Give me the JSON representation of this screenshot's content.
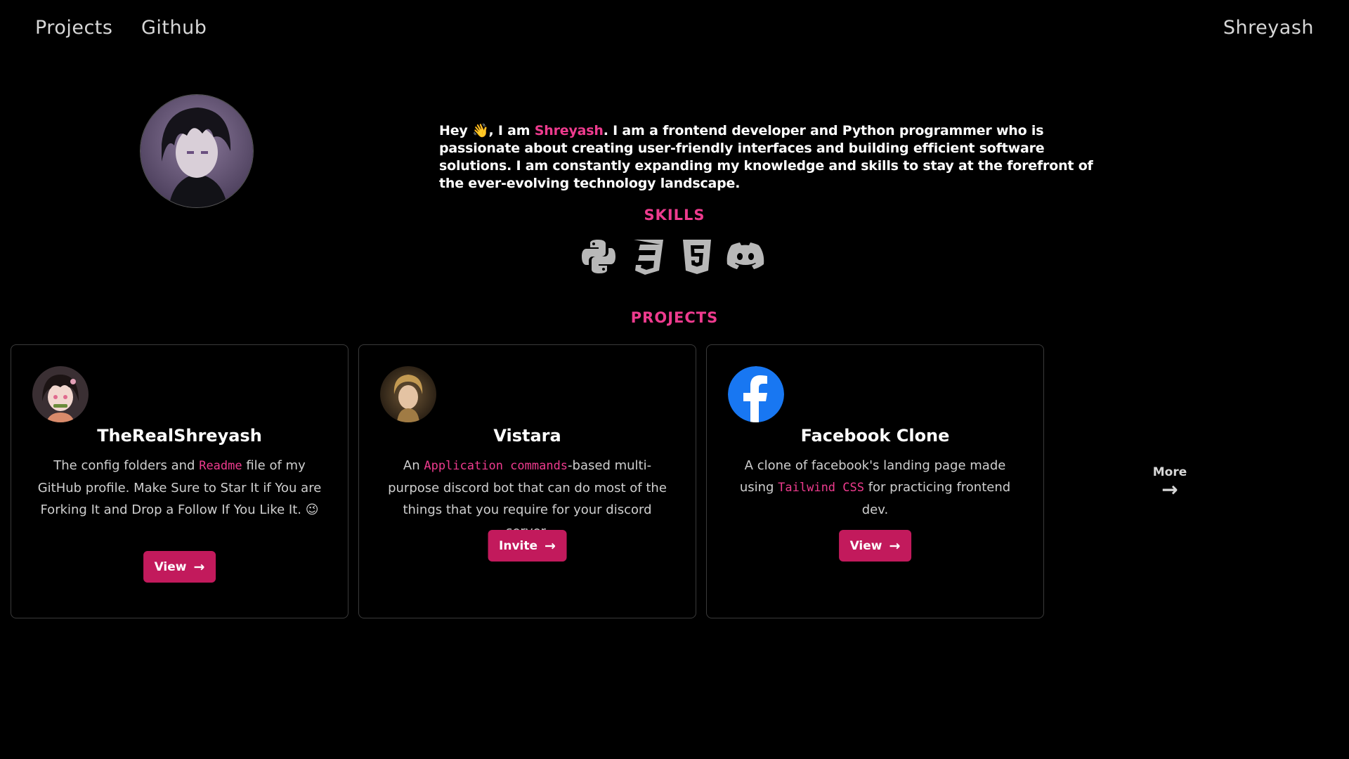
{
  "nav": {
    "projects": "Projects",
    "github": "Github",
    "brand": "Shreyash"
  },
  "bio": {
    "pre": "Hey 👋, I am ",
    "name": "Shreyash",
    "post": ". I am a frontend developer and Python programmer who is passionate about creating user-friendly interfaces and building efficient software solutions. I am constantly expanding my knowledge and skills to stay at the forefront of the ever-evolving technology landscape."
  },
  "skills": {
    "title": "SKILLS",
    "icons": [
      "python-icon",
      "css3-icon",
      "html5-icon",
      "discord-icon"
    ]
  },
  "projects": {
    "title": "PROJECTS",
    "cards": [
      {
        "title": "TheRealShreyash",
        "desc_before": "The config folders and ",
        "desc_code": "Readme",
        "desc_after": " file of my GitHub profile. Make Sure to Star It if You are Forking It and Drop a Follow If You Like It. 😉",
        "button": "View"
      },
      {
        "title": "Vistara",
        "desc_before": "An ",
        "desc_code": "Application commands",
        "desc_after": "-based multi-purpose discord bot that can do most of the things that you require for your discord server.",
        "button": "Invite"
      },
      {
        "title": "Facebook Clone",
        "desc_before": "A clone of facebook's landing page made using ",
        "desc_code": "Tailwind CSS",
        "desc_after": " for practicing frontend dev.",
        "button": "View"
      }
    ],
    "more": "More"
  },
  "colors": {
    "accent": "#ee3b8e",
    "button": "#c21a5c",
    "background": "#000000"
  }
}
